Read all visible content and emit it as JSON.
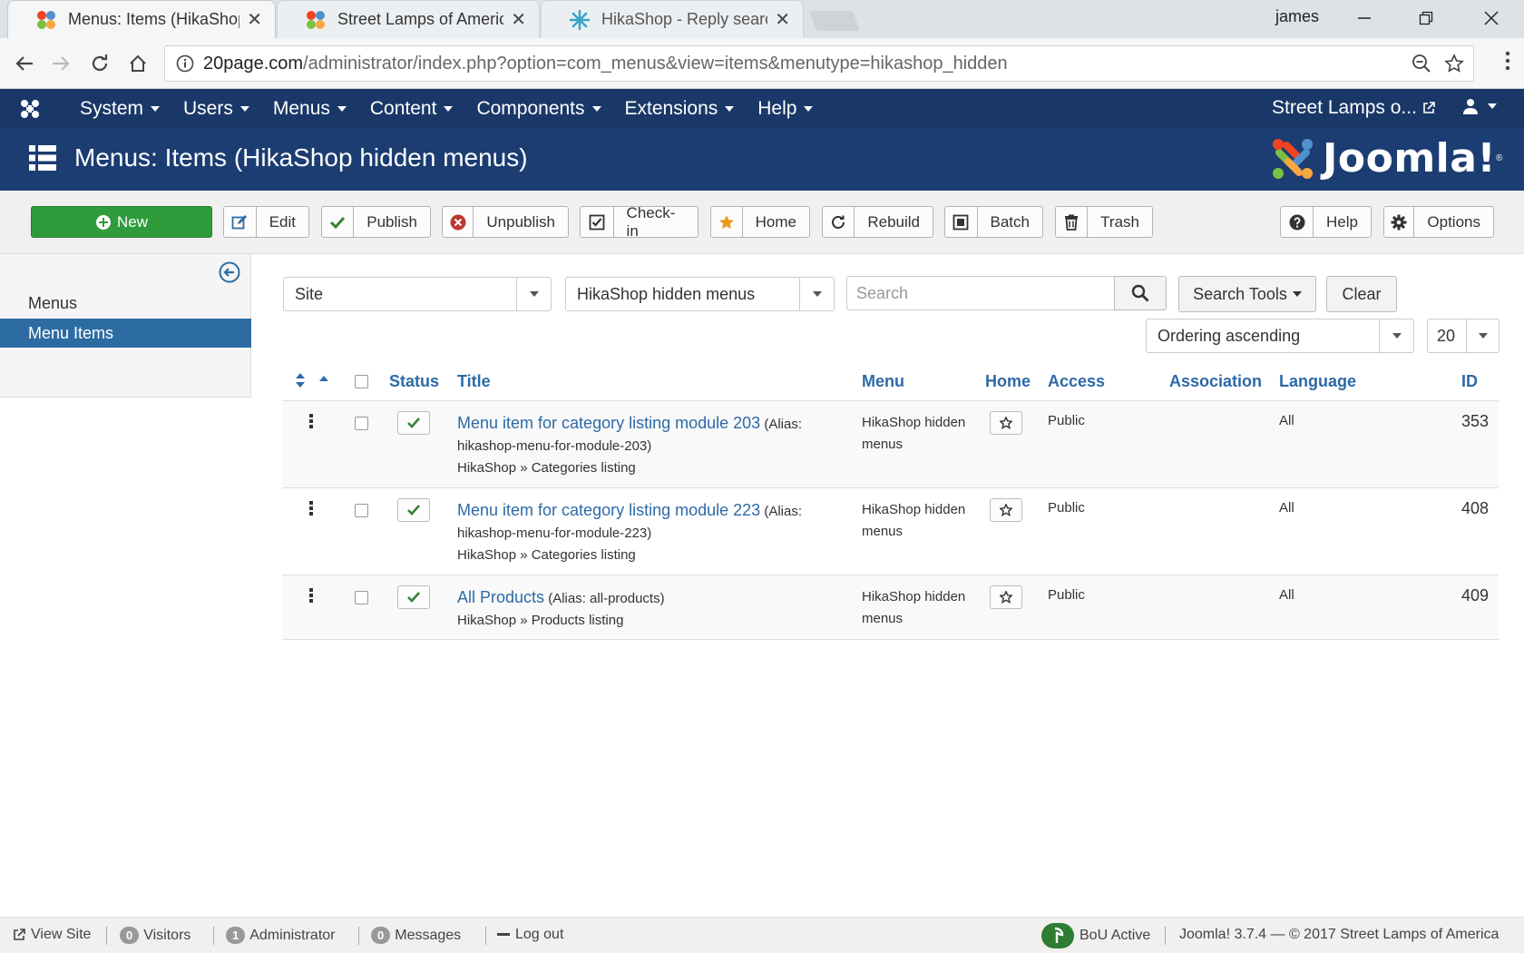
{
  "browser": {
    "tabs": [
      {
        "label": "Menus: Items (HikaShop"
      },
      {
        "label": "Street Lamps of America"
      },
      {
        "label": "HikaShop - Reply search"
      }
    ],
    "user": "james",
    "url_host": "20page.com",
    "url_path": "/administrator/index.php?option=com_menus&view=items&menutype=hikashop_hidden"
  },
  "nav": {
    "items": [
      "System",
      "Users",
      "Menus",
      "Content",
      "Components",
      "Extensions",
      "Help"
    ],
    "site": "Street Lamps o..."
  },
  "header": {
    "title": "Menus: Items (HikaShop hidden menus)",
    "brand": "Joomla!"
  },
  "toolbar": {
    "new": "New",
    "edit": "Edit",
    "publish": "Publish",
    "unpublish": "Unpublish",
    "checkin": "Check-in",
    "home": "Home",
    "rebuild": "Rebuild",
    "batch": "Batch",
    "trash": "Trash",
    "help": "Help",
    "options": "Options"
  },
  "sidebar": {
    "items": [
      "Menus",
      "Menu Items"
    ]
  },
  "filters": {
    "site": "Site",
    "menu": "HikaShop hidden menus",
    "search_placeholder": "Search",
    "search_tools": "Search Tools",
    "clear": "Clear",
    "ordering": "Ordering ascending",
    "limit": "20"
  },
  "table": {
    "headers": {
      "status": "Status",
      "title": "Title",
      "menu": "Menu",
      "home": "Home",
      "access": "Access",
      "association": "Association",
      "language": "Language",
      "id": "ID"
    },
    "rows": [
      {
        "title": "Menu item for category listing module 203",
        "alias_line1": "(Alias:",
        "alias_line2": "hikashop-menu-for-module-203)",
        "type": "HikaShop » Categories listing",
        "menu1": "HikaShop hidden",
        "menu2": "menus",
        "access": "Public",
        "language": "All",
        "id": "353"
      },
      {
        "title": "Menu item for category listing module 223",
        "alias_line1": "(Alias:",
        "alias_line2": "hikashop-menu-for-module-223)",
        "type": "HikaShop » Categories listing",
        "menu1": "HikaShop hidden",
        "menu2": "menus",
        "access": "Public",
        "language": "All",
        "id": "408"
      },
      {
        "title": "All Products",
        "alias_line1": "(Alias: all-products)",
        "type": "HikaShop » Products listing",
        "menu1": "HikaShop hidden",
        "menu2": "menus",
        "access": "Public",
        "language": "All",
        "id": "409"
      }
    ]
  },
  "footer": {
    "view_site": "View Site",
    "visitors_count": "0",
    "visitors": "Visitors",
    "admin_count": "1",
    "admin": "Administrator",
    "messages_count": "0",
    "messages": "Messages",
    "logout": "Log out",
    "bou": "BoU Active",
    "version": "Joomla! 3.7.4 — © 2017 Street Lamps of America"
  },
  "colors": {
    "nav_bg": "#1a3867",
    "header_bg": "#1c3d72",
    "new_btn": "#2f9b3b",
    "link": "#2e6aa7",
    "active_sidebar": "#2d6ca2"
  }
}
